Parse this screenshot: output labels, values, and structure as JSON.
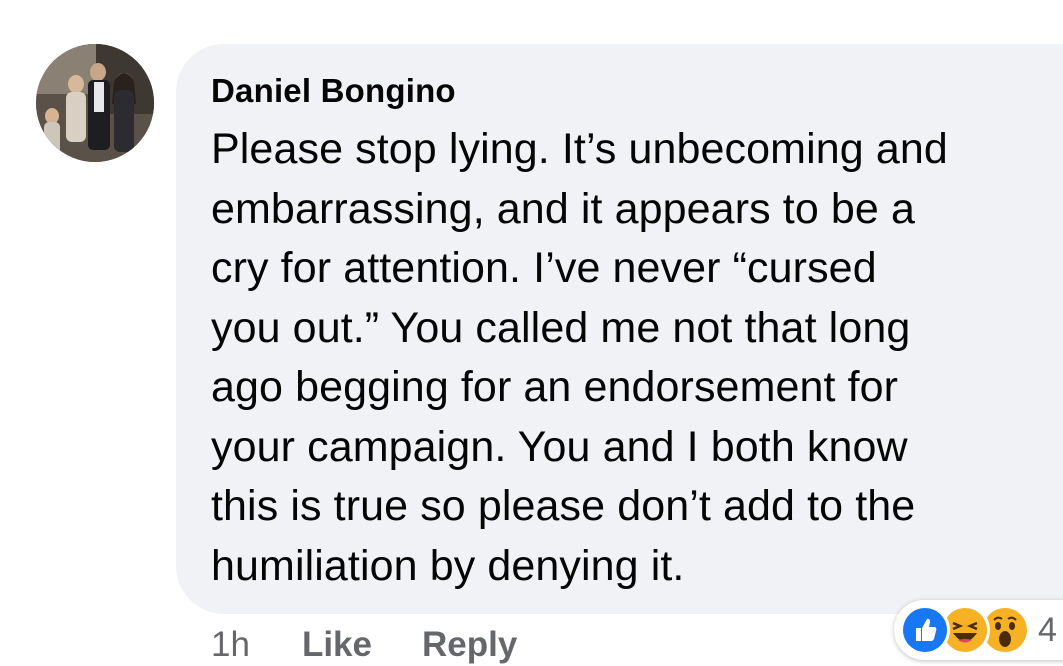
{
  "comment": {
    "author": "Daniel Bongino",
    "text": "Please stop lying. It’s unbecoming and\nembarrassing, and it appears to be a\ncry for attention. I’ve never “cursed\nyou out.” You called me not that long\nago begging for an endorsement for\nyour campaign. You and I both know\nthis is true so please don’t add to the\nhumiliation by denying it.",
    "timestamp": "1h",
    "like_label": "Like",
    "reply_label": "Reply",
    "reactions": {
      "icons": [
        "like-icon",
        "haha-icon",
        "wow-icon"
      ],
      "count": "4"
    }
  },
  "colors": {
    "bubble": "#f0f2f5",
    "text": "#050505",
    "secondary": "#65676b",
    "like_blue": "#1877f2",
    "emoji_yellow": "#f7b125"
  }
}
